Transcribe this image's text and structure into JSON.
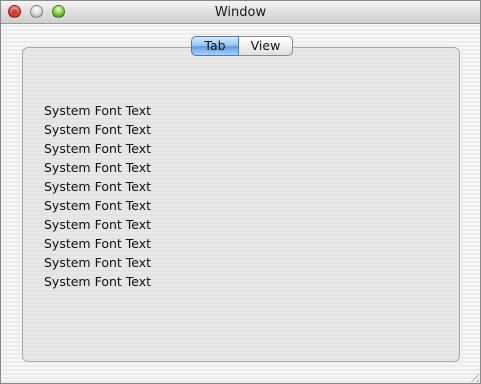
{
  "window": {
    "title": "Window"
  },
  "tabs": [
    {
      "label": "Tab",
      "selected": true
    },
    {
      "label": "View",
      "selected": false
    }
  ],
  "content": {
    "lines": [
      "System Font Text",
      "System Font Text",
      "System Font Text",
      "System Font Text",
      "System Font Text",
      "System Font Text",
      "System Font Text",
      "System Font Text",
      "System Font Text",
      "System Font Text"
    ]
  },
  "colors": {
    "selected_tab": "#8fc2f5",
    "close_button": "#e2483a",
    "zoom_button": "#7cc83b"
  }
}
